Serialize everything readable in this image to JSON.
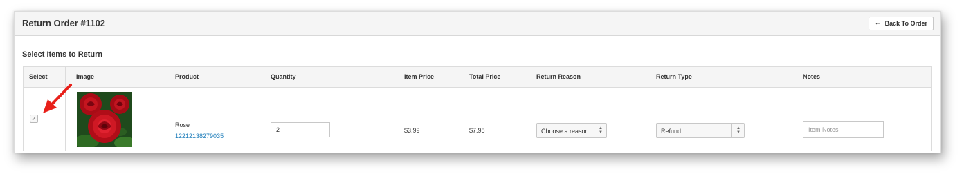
{
  "header": {
    "title": "Return Order #1102",
    "back_button_label": "Back To Order",
    "back_icon": "arrow-left-icon"
  },
  "section": {
    "title": "Select Items to Return"
  },
  "table": {
    "columns": [
      "Select",
      "Image",
      "Product",
      "Quantity",
      "Item Price",
      "Total Price",
      "Return Reason",
      "Return Type",
      "Notes"
    ],
    "rows": [
      {
        "selected": true,
        "image": "rose-image",
        "product_name": "Rose",
        "product_sku": "12212138279035",
        "quantity": "2",
        "item_price": "$3.99",
        "total_price": "$7.98",
        "return_reason": "Choose a reason",
        "return_type": "Refund",
        "notes_placeholder": "Item Notes"
      }
    ]
  },
  "annotation": {
    "arrow_color": "#e8201a"
  },
  "colors": {
    "link": "#1a7bb9",
    "header_bg": "#f5f5f5",
    "border": "#dcdcdc"
  }
}
